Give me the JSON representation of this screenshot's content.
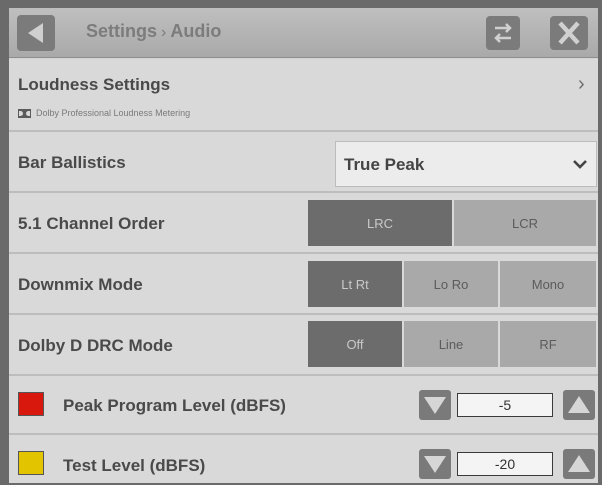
{
  "header": {
    "crumb_root": "Settings",
    "crumb_sep": "›",
    "crumb_page": "Audio",
    "back_icon": "back-arrow-icon",
    "swap_icon": "swap-arrows-icon",
    "close_icon": "close-icon"
  },
  "loudness": {
    "label": "Loudness Settings",
    "sub_text": "Dolby Professional Loudness Metering",
    "sub_icon": "dolby-icon",
    "chevron": "›"
  },
  "bar_ballistics": {
    "label": "Bar Ballistics",
    "value": "True Peak"
  },
  "channel_order": {
    "label": "5.1 Channel Order",
    "options": [
      {
        "label": "LRC",
        "selected": true
      },
      {
        "label": "LCR",
        "selected": false
      }
    ]
  },
  "downmix": {
    "label": "Downmix Mode",
    "options": [
      {
        "label": "Lt Rt",
        "selected": true
      },
      {
        "label": "Lo Ro",
        "selected": false
      },
      {
        "label": "Mono",
        "selected": false
      }
    ]
  },
  "drc": {
    "label": "Dolby D DRC Mode",
    "options": [
      {
        "label": "Off",
        "selected": true
      },
      {
        "label": "Line",
        "selected": false
      },
      {
        "label": "RF",
        "selected": false
      }
    ]
  },
  "peak_level": {
    "label": "Peak Program Level (dBFS)",
    "value": "-5",
    "color": "#d8170d"
  },
  "test_level": {
    "label": "Test Level (dBFS)",
    "value": "-20",
    "color": "#e2c400"
  },
  "colors": {
    "selected_segment": "#6c6c6c",
    "unselected_segment": "#a9a9a9",
    "row_background": "#d9d9d9"
  }
}
